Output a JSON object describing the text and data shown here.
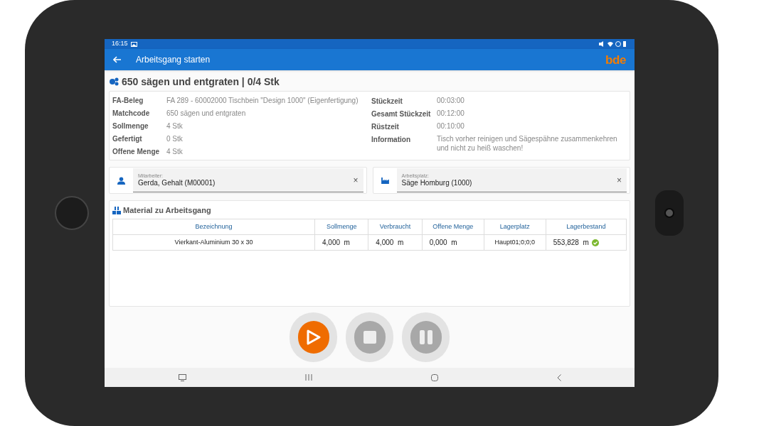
{
  "status_bar": {
    "time": "16:15"
  },
  "app_bar": {
    "title": "Arbeitsgang starten",
    "logo": "bde"
  },
  "operation": {
    "title": "650 sägen und entgraten | 0/4 Stk"
  },
  "details_left": [
    {
      "label": "FA-Beleg",
      "value": "FA 289 - 60002000 Tischbein \"Design 1000\" (Eigenfertigung)"
    },
    {
      "label": "Matchcode",
      "value": "650 sägen und entgraten"
    },
    {
      "label": "Sollmenge",
      "value": "4 Stk"
    },
    {
      "label": "Gefertigt",
      "value": "0 Stk"
    },
    {
      "label": "Offene Menge",
      "value": "4 Stk"
    }
  ],
  "details_right": [
    {
      "label": "Stückzeit",
      "value": "00:03:00"
    },
    {
      "label": "Gesamt Stückzeit",
      "value": "00:12:00"
    },
    {
      "label": "Rüstzeit",
      "value": "00:10:00"
    },
    {
      "label": "Information",
      "value": "Tisch vorher reinigen und Sägespähne zusammenkehren und nicht zu heiß waschen!"
    }
  ],
  "fields": [
    {
      "kind": "person",
      "label": "Mitarbeiter:",
      "value": "Gerda, Gehalt (M00001)",
      "clear": "×"
    },
    {
      "kind": "workplace",
      "label": "Arbeitsplatz:",
      "value": "Säge Homburg (1000)",
      "clear": "×"
    }
  ],
  "material": {
    "title": "Material zu Arbeitsgang",
    "columns": [
      "Bezeichnung",
      "Sollmenge",
      "Verbraucht",
      "Offene Menge",
      "Lagerplatz",
      "Lagerbestand"
    ],
    "rows": [
      {
        "cells": [
          "Vierkant-Aluminium 30 x 30",
          "4,000  m",
          "4,000  m",
          "0,000  m",
          "Haupt01;0;0;0",
          "553,828  m"
        ],
        "in_stock": true
      }
    ]
  },
  "controls": [
    {
      "kind": "play",
      "disabled": false
    },
    {
      "kind": "stop",
      "disabled": true
    },
    {
      "kind": "pause",
      "disabled": true
    }
  ]
}
